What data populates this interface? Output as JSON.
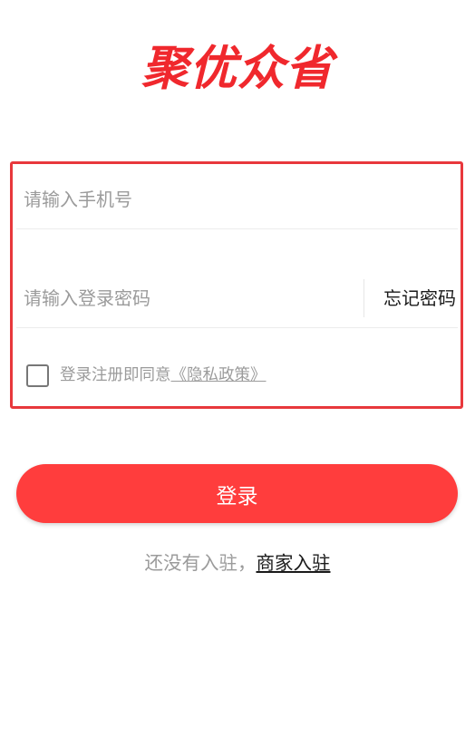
{
  "app": {
    "logo_text": "聚优众省"
  },
  "form": {
    "phone": {
      "placeholder": "请输入手机号",
      "value": ""
    },
    "password": {
      "placeholder": "请输入登录密码",
      "value": ""
    },
    "forgot_password_label": "忘记密码",
    "agreement": {
      "checked": false,
      "prefix": "登录注册即同意",
      "policy_link": "《隐私政策》"
    }
  },
  "login_button": {
    "label": "登录"
  },
  "register": {
    "prefix": "还没有入驻，",
    "link": "商家入驻"
  },
  "colors": {
    "brand_red": "#f0282d",
    "button_red": "#ff3d3d",
    "highlight_border": "#e8383c",
    "placeholder_gray": "#9b9b9b",
    "text_dark": "#1a1a1a"
  }
}
